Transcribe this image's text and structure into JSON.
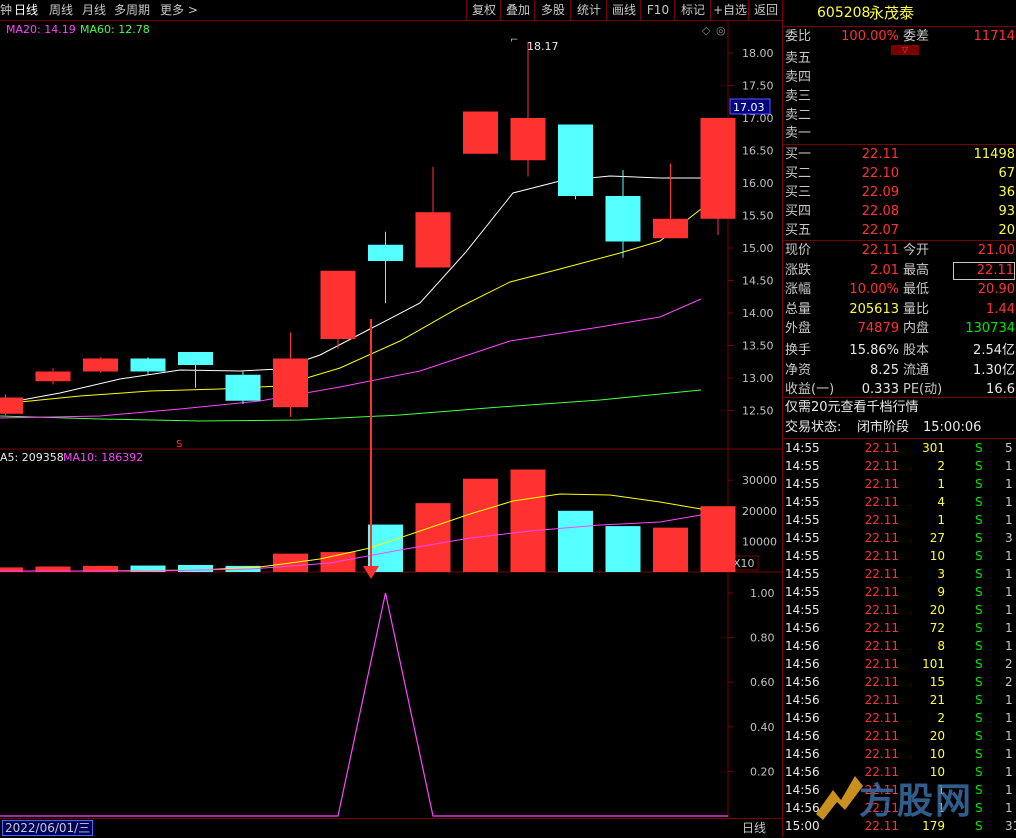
{
  "toolbar": {
    "left": [
      "钟",
      "日线",
      "周线",
      "月线",
      "多周期",
      "更多 >"
    ],
    "right": [
      "复权",
      "叠加",
      "多股",
      "统计",
      "画线",
      "F10",
      "标记",
      "+自选",
      "返回"
    ]
  },
  "main": {
    "ma_labels": [
      {
        "text": "MA20: 14.19",
        "color": "#ff44ff"
      },
      {
        "text": "MA60: 12.78",
        "color": "#44ff44"
      }
    ],
    "price_axis": [
      "18.00",
      "17.50",
      "17.00",
      "16.50",
      "16.00",
      "15.50",
      "15.00",
      "14.50",
      "14.00",
      "13.50",
      "13.00",
      "12.50"
    ],
    "current_price_marker": "17.03",
    "high_label": "18.17",
    "signal_mark": "S",
    "vol_labels": [
      {
        "text": "A5: 209358",
        "color": "#e8e8e8"
      },
      {
        "text": "MA10: 186392",
        "color": "#ff44ff"
      }
    ],
    "vol_axis": [
      "30000",
      "20000",
      "10000"
    ],
    "vol_unit": "X10",
    "ind_axis": [
      "1.00",
      "0.80",
      "0.60",
      "0.40",
      "0.20"
    ],
    "date_label": "2022/06/01/三",
    "period_label": "日线"
  },
  "colors": {
    "up": "#ff3232",
    "down": "#54ffff",
    "ma5": "#ffffff",
    "ma10": "#ffff00",
    "ma20": "#ff44ff",
    "ma60": "#44ff44",
    "border": "#7a0000"
  },
  "candles": [
    {
      "o": 12.45,
      "c": 12.7,
      "h": 12.75,
      "l": 12.4
    },
    {
      "o": 12.95,
      "c": 13.1,
      "h": 13.15,
      "l": 12.9
    },
    {
      "o": 13.1,
      "c": 13.3,
      "h": 13.32,
      "l": 13.08
    },
    {
      "o": 13.3,
      "c": 13.1,
      "h": 13.32,
      "l": 13.05
    },
    {
      "o": 13.4,
      "c": 13.2,
      "h": 13.4,
      "l": 12.85
    },
    {
      "o": 13.05,
      "c": 12.65,
      "h": 13.1,
      "l": 12.6
    },
    {
      "o": 12.55,
      "c": 13.3,
      "h": 13.7,
      "l": 12.4
    },
    {
      "o": 13.6,
      "c": 14.65,
      "h": 14.65,
      "l": 13.45
    },
    {
      "o": 15.05,
      "c": 14.8,
      "h": 15.25,
      "l": 14.15
    },
    {
      "o": 14.7,
      "c": 15.55,
      "h": 16.25,
      "l": 14.7
    },
    {
      "o": 16.45,
      "c": 17.1,
      "h": 17.1,
      "l": 16.45
    },
    {
      "o": 16.35,
      "c": 17.0,
      "h": 18.17,
      "l": 16.1
    },
    {
      "o": 16.9,
      "c": 15.8,
      "h": 16.9,
      "l": 15.75
    },
    {
      "o": 15.8,
      "c": 15.1,
      "h": 16.2,
      "l": 14.85
    },
    {
      "o": 15.15,
      "c": 15.45,
      "h": 16.3,
      "l": 15.15
    },
    {
      "o": 15.45,
      "c": 17.0,
      "h": 17.0,
      "l": 15.2
    }
  ],
  "volumes": [
    1500,
    1800,
    2000,
    2100,
    2300,
    2000,
    6000,
    6500,
    15500,
    22500,
    30500,
    33500,
    20000,
    15000,
    14500,
    21500
  ],
  "indicator": [
    0,
    0,
    0,
    0,
    0,
    0,
    0,
    0,
    1,
    0,
    0,
    0,
    0,
    0,
    0,
    0
  ],
  "quote": {
    "code": "605208",
    "name": "永茂泰",
    "weibi_label": "委比",
    "weibi": "100.00%",
    "weicha_label": "委差",
    "weicha": "11714",
    "sell": [
      {
        "label": "卖五"
      },
      {
        "label": "卖四"
      },
      {
        "label": "卖三"
      },
      {
        "label": "卖二"
      },
      {
        "label": "卖一"
      }
    ],
    "buy": [
      {
        "label": "买一",
        "price": "22.11",
        "vol": "11498"
      },
      {
        "label": "买二",
        "price": "22.10",
        "vol": "67"
      },
      {
        "label": "买三",
        "price": "22.09",
        "vol": "36"
      },
      {
        "label": "买四",
        "price": "22.08",
        "vol": "93"
      },
      {
        "label": "买五",
        "price": "22.07",
        "vol": "20"
      }
    ],
    "stats": [
      {
        "l1": "现价",
        "v1": "22.11",
        "c1": "red",
        "l2": "今开",
        "v2": "21.00",
        "c2": "red"
      },
      {
        "l1": "涨跌",
        "v1": "2.01",
        "c1": "red",
        "l2": "最高",
        "v2": "22.11",
        "c2": "red"
      },
      {
        "l1": "涨幅",
        "v1": "10.00%",
        "c1": "red",
        "l2": "最低",
        "v2": "20.90",
        "c2": "red"
      },
      {
        "l1": "总量",
        "v1": "205613",
        "c1": "yel",
        "l2": "量比",
        "v2": "1.44",
        "c2": "red"
      },
      {
        "l1": "外盘",
        "v1": "74879",
        "c1": "red",
        "l2": "内盘",
        "v2": "130734",
        "c2": "grn"
      },
      {
        "l1": "换手",
        "v1": "15.86%",
        "c1": "wht",
        "l2": "股本",
        "v2": "2.54亿",
        "c2": "wht"
      },
      {
        "l1": "净资",
        "v1": "8.25",
        "c1": "wht",
        "l2": "流通",
        "v2": "1.30亿",
        "c2": "wht"
      },
      {
        "l1": "收益(一)",
        "v1": "0.333",
        "c1": "wht",
        "l2": "PE(动)",
        "v2": "16.6",
        "c2": "wht"
      }
    ],
    "promo": "仅需20元查看千档行情",
    "status_label": "交易状态:",
    "status_value": "闭市阶段",
    "status_time": "15:00:06"
  },
  "ticks": [
    {
      "t": "14:55",
      "p": "22.11",
      "q": "301",
      "s": "S",
      "n": "5"
    },
    {
      "t": "14:55",
      "p": "22.11",
      "q": "2",
      "s": "S",
      "n": "1"
    },
    {
      "t": "14:55",
      "p": "22.11",
      "q": "1",
      "s": "S",
      "n": "1"
    },
    {
      "t": "14:55",
      "p": "22.11",
      "q": "4",
      "s": "S",
      "n": "1"
    },
    {
      "t": "14:55",
      "p": "22.11",
      "q": "1",
      "s": "S",
      "n": "1"
    },
    {
      "t": "14:55",
      "p": "22.11",
      "q": "27",
      "s": "S",
      "n": "3"
    },
    {
      "t": "14:55",
      "p": "22.11",
      "q": "10",
      "s": "S",
      "n": "1"
    },
    {
      "t": "14:55",
      "p": "22.11",
      "q": "3",
      "s": "S",
      "n": "1"
    },
    {
      "t": "14:55",
      "p": "22.11",
      "q": "9",
      "s": "S",
      "n": "1"
    },
    {
      "t": "14:55",
      "p": "22.11",
      "q": "20",
      "s": "S",
      "n": "1"
    },
    {
      "t": "14:56",
      "p": "22.11",
      "q": "72",
      "s": "S",
      "n": "1"
    },
    {
      "t": "14:56",
      "p": "22.11",
      "q": "8",
      "s": "S",
      "n": "1"
    },
    {
      "t": "14:56",
      "p": "22.11",
      "q": "101",
      "s": "S",
      "n": "2"
    },
    {
      "t": "14:56",
      "p": "22.11",
      "q": "15",
      "s": "S",
      "n": "2"
    },
    {
      "t": "14:56",
      "p": "22.11",
      "q": "21",
      "s": "S",
      "n": "1"
    },
    {
      "t": "14:56",
      "p": "22.11",
      "q": "2",
      "s": "S",
      "n": "1"
    },
    {
      "t": "14:56",
      "p": "22.11",
      "q": "20",
      "s": "S",
      "n": "1"
    },
    {
      "t": "14:56",
      "p": "22.11",
      "q": "10",
      "s": "S",
      "n": "1"
    },
    {
      "t": "14:56",
      "p": "22.11",
      "q": "10",
      "s": "S",
      "n": "1"
    },
    {
      "t": "14:56",
      "p": "22.11",
      "q": "1",
      "s": "S",
      "n": "1"
    },
    {
      "t": "14:56",
      "p": "22.11",
      "q": "1",
      "s": "S",
      "n": "1"
    },
    {
      "t": "15:00",
      "p": "22.11",
      "q": "179",
      "s": "S",
      "n": "31"
    }
  ],
  "watermark": "方股网"
}
